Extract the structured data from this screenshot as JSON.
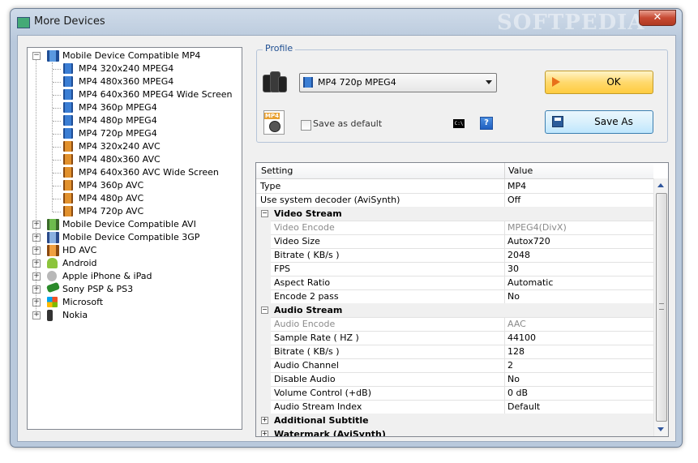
{
  "window": {
    "title": "More Devices",
    "watermark": "SOFTPEDIA",
    "close_label": "✕"
  },
  "tree": {
    "root_expanded": {
      "label": "Mobile Device Compatible MP4",
      "children": [
        {
          "label": "MP4 320x240 MPEG4",
          "icon": "mp4-icon"
        },
        {
          "label": "MP4 480x360 MPEG4",
          "icon": "mp4-icon"
        },
        {
          "label": "MP4 640x360 MPEG4 Wide Screen",
          "icon": "mp4-icon"
        },
        {
          "label": "MP4 360p MPEG4",
          "icon": "mp4-icon"
        },
        {
          "label": "MP4 480p MPEG4",
          "icon": "mp4-icon"
        },
        {
          "label": "MP4 720p MPEG4",
          "icon": "mp4-icon"
        },
        {
          "label": "MP4 320x240 AVC",
          "icon": "avc-icon"
        },
        {
          "label": "MP4 480x360 AVC",
          "icon": "avc-icon"
        },
        {
          "label": "MP4 640x360 AVC Wide Screen",
          "icon": "avc-icon"
        },
        {
          "label": "MP4 360p AVC",
          "icon": "avc-icon"
        },
        {
          "label": "MP4 480p AVC",
          "icon": "avc-icon"
        },
        {
          "label": "MP4 720p AVC",
          "icon": "avc-icon"
        }
      ]
    },
    "collapsed": [
      {
        "label": "Mobile Device Compatible AVI",
        "icon": "avi-folder-icon"
      },
      {
        "label": "Mobile Device Compatible 3GP",
        "icon": "3gp-folder-icon"
      },
      {
        "label": "HD AVC",
        "icon": "hd-icon"
      },
      {
        "label": "Android",
        "icon": "android-icon"
      },
      {
        "label": "Apple iPhone & iPad",
        "icon": "apple-icon"
      },
      {
        "label": "Sony PSP & PS3",
        "icon": "psp-icon"
      },
      {
        "label": "Microsoft",
        "icon": "microsoft-icon"
      },
      {
        "label": "Nokia",
        "icon": "nokia-icon"
      }
    ]
  },
  "profile": {
    "legend": "Profile",
    "selected": "MP4 720p MPEG4",
    "save_default_label": "Save as default",
    "save_default_checked": false,
    "cmd_icon_text": "C:\\",
    "help_label": "?",
    "ok_label": "OK",
    "save_as_label": "Save As"
  },
  "grid": {
    "headers": {
      "setting": "Setting",
      "value": "Value"
    },
    "rows": [
      {
        "kind": "item",
        "name": "Type",
        "value": "MP4",
        "indent": false
      },
      {
        "kind": "item",
        "name": "Use system decoder (AviSynth)",
        "value": "Off",
        "indent": false
      },
      {
        "kind": "category",
        "name": "Video Stream",
        "expander": "−"
      },
      {
        "kind": "item",
        "name": "Video Encode",
        "value": "MPEG4(DivX)",
        "indent": true,
        "dim": true
      },
      {
        "kind": "item",
        "name": "Video Size",
        "value": "Autox720",
        "indent": true
      },
      {
        "kind": "item",
        "name": "Bitrate ( KB/s )",
        "value": "2048",
        "indent": true
      },
      {
        "kind": "item",
        "name": "FPS",
        "value": "30",
        "indent": true
      },
      {
        "kind": "item",
        "name": "Aspect Ratio",
        "value": "Automatic",
        "indent": true
      },
      {
        "kind": "item",
        "name": "Encode 2 pass",
        "value": "No",
        "indent": true
      },
      {
        "kind": "category",
        "name": "Audio Stream",
        "expander": "−"
      },
      {
        "kind": "item",
        "name": "Audio Encode",
        "value": "AAC",
        "indent": true,
        "dim": true
      },
      {
        "kind": "item",
        "name": "Sample Rate ( HZ )",
        "value": "44100",
        "indent": true
      },
      {
        "kind": "item",
        "name": "Bitrate ( KB/s )",
        "value": "128",
        "indent": true
      },
      {
        "kind": "item",
        "name": "Audio Channel",
        "value": "2",
        "indent": true
      },
      {
        "kind": "item",
        "name": "Disable Audio",
        "value": "No",
        "indent": true
      },
      {
        "kind": "item",
        "name": "Volume Control (+dB)",
        "value": "0 dB",
        "indent": true
      },
      {
        "kind": "item",
        "name": "Audio Stream Index",
        "value": "Default",
        "indent": true
      },
      {
        "kind": "category",
        "name": "Additional Subtitle",
        "expander": "+"
      },
      {
        "kind": "category",
        "name": "Watermark (AviSynth)",
        "expander": "+"
      }
    ]
  }
}
